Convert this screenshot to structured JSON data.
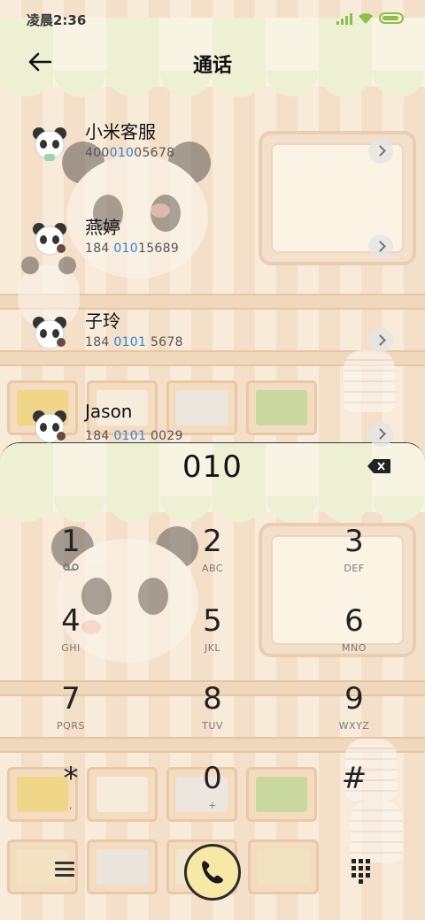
{
  "status_bar": {
    "time": "凌晨2:36"
  },
  "header": {
    "title": "通话"
  },
  "contacts": [
    {
      "name": "小米客服",
      "number_pre": "400",
      "number_match": "010",
      "number_post": "05678"
    },
    {
      "name": "燕婷",
      "number_pre": "184 ",
      "number_match": "010",
      "number_post": "15689"
    },
    {
      "name": "子玲",
      "number_pre": "184 ",
      "number_match": "0101",
      "number_post": " 5678"
    },
    {
      "name": "Jason",
      "number_pre": "184 ",
      "number_match": "0101",
      "number_post": " 0029"
    }
  ],
  "dialer": {
    "input_value": "010",
    "keys": [
      {
        "num": "1",
        "sub": ""
      },
      {
        "num": "2",
        "sub": "ABC"
      },
      {
        "num": "3",
        "sub": "DEF"
      },
      {
        "num": "4",
        "sub": "GHI"
      },
      {
        "num": "5",
        "sub": "JKL"
      },
      {
        "num": "6",
        "sub": "MNO"
      },
      {
        "num": "7",
        "sub": "PQRS"
      },
      {
        "num": "8",
        "sub": "TUV"
      },
      {
        "num": "9",
        "sub": "WXYZ"
      },
      {
        "num": "*",
        "sub": ","
      },
      {
        "num": "0",
        "sub": "+"
      },
      {
        "num": "#",
        "sub": ""
      }
    ]
  },
  "colors": {
    "match_highlight": "#2f86d6",
    "call_button": "#f7e8a6",
    "battery": "#8bbf4a",
    "background": "#f7e7d4"
  },
  "icons": {
    "back": "arrow-left-icon",
    "delete": "backspace-icon",
    "menu": "menu-icon",
    "call": "phone-icon",
    "keypad_toggle": "keypad-icon",
    "voicemail": "voicemail-icon",
    "contact_arrow": "chevron-right-icon"
  }
}
